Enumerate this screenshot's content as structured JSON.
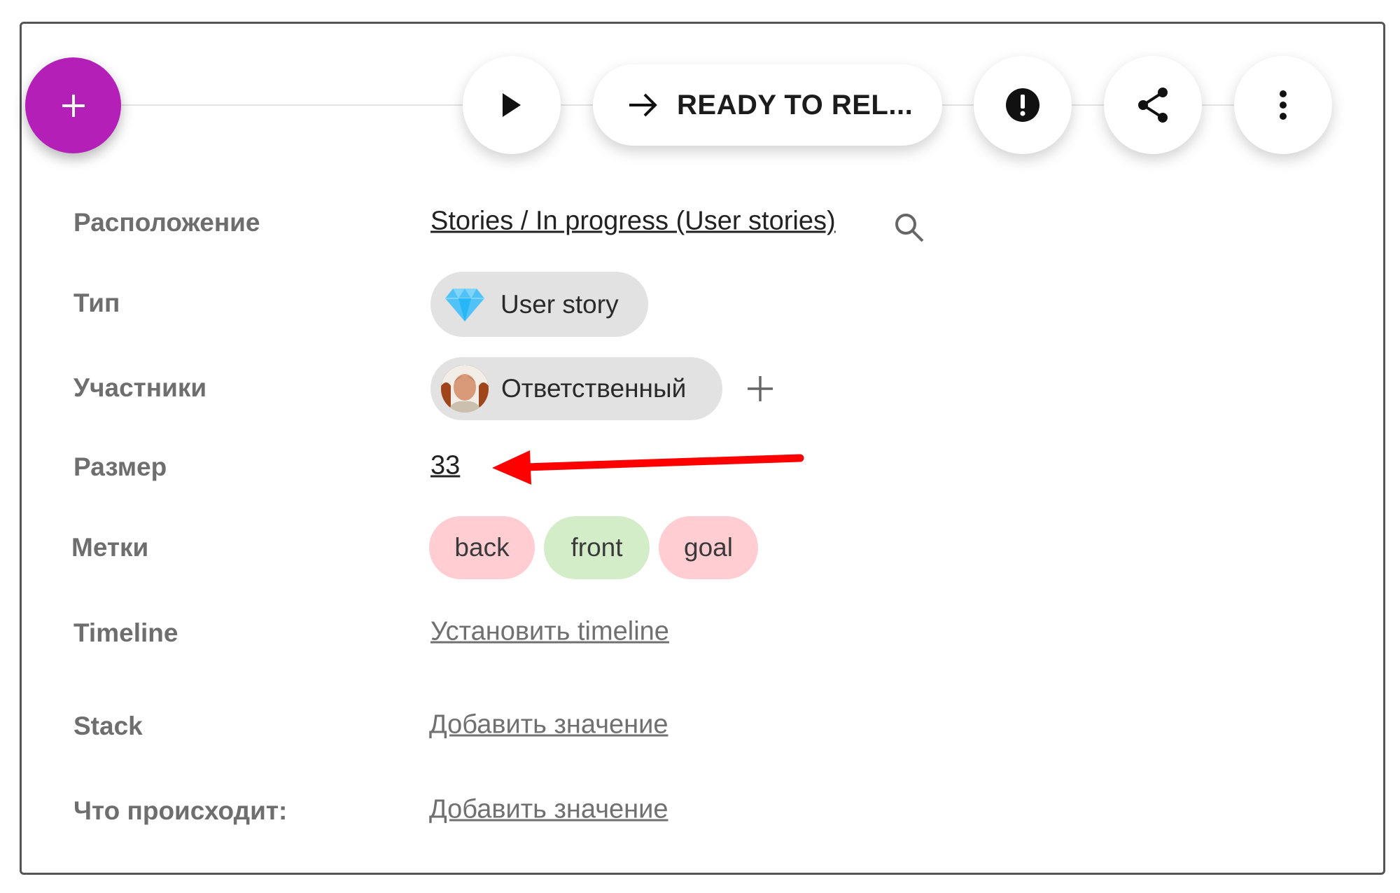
{
  "toolbar": {
    "add_label": "+",
    "status_label": "READY TO REL...",
    "accent_color": "#b31fb7"
  },
  "fields": {
    "location": {
      "label": "Расположение",
      "value": "Stories / In progress (User stories)"
    },
    "type": {
      "label": "Тип",
      "value": "User story",
      "icon": "gem-icon"
    },
    "members": {
      "label": "Участники",
      "assignee": "Ответственный"
    },
    "size": {
      "label": "Размер",
      "value": "33"
    },
    "tags": {
      "label": "Метки",
      "items": [
        {
          "name": "back",
          "color": "#ffcdd2"
        },
        {
          "name": "front",
          "color": "#d4edc9"
        },
        {
          "name": "goal",
          "color": "#ffcdd2"
        }
      ]
    },
    "timeline": {
      "label": "Timeline",
      "value": "Установить timeline"
    },
    "stack": {
      "label": "Stack",
      "value": "Добавить значение"
    },
    "happening": {
      "label": "Что происходит:",
      "value": "Добавить значение"
    }
  },
  "annotation": {
    "color": "#ff0000",
    "target": "size-value"
  }
}
